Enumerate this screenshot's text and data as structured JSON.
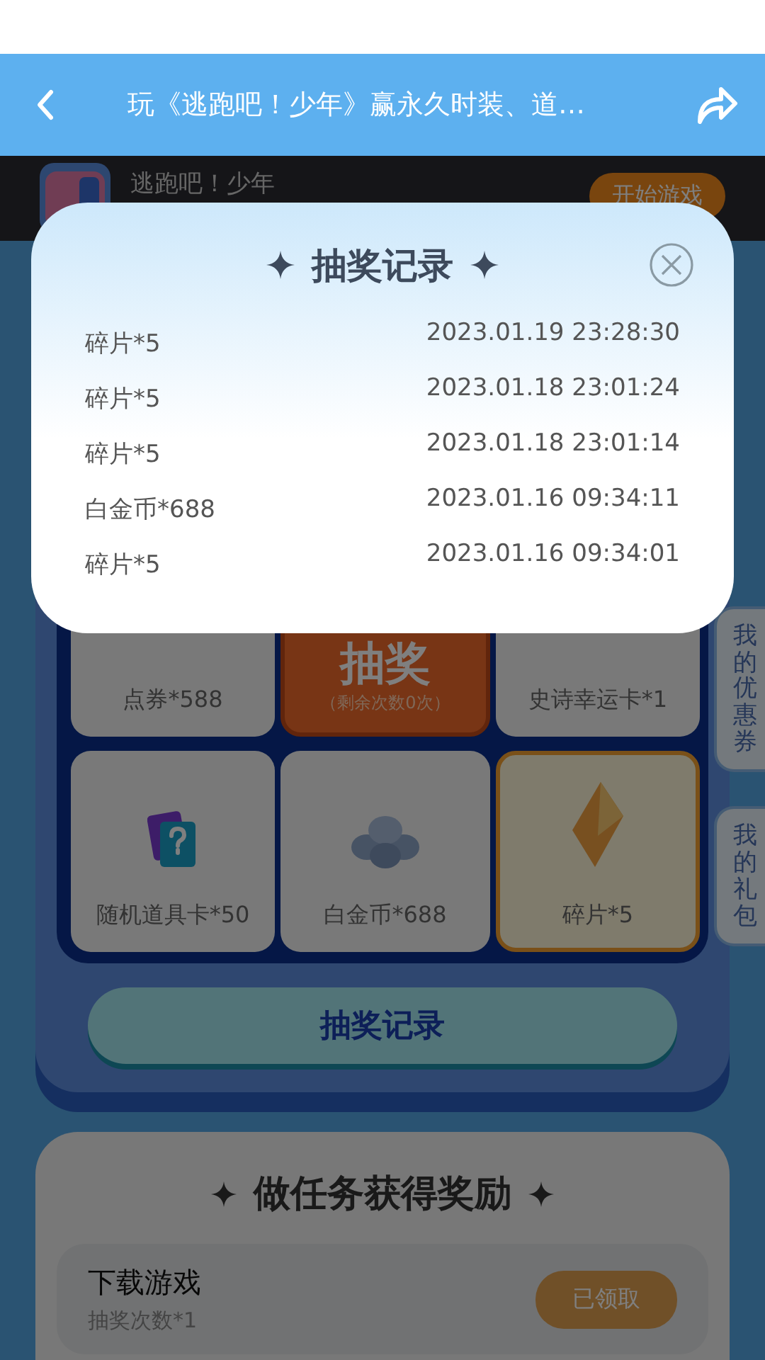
{
  "header": {
    "title": "玩《逃跑吧！少年》赢永久时装、道…"
  },
  "game": {
    "name": "逃跑吧！少年",
    "button": "开始游戏"
  },
  "prizes": [
    {
      "kind": "prize",
      "label": "点券*588",
      "selected": false
    },
    {
      "kind": "draw",
      "label": "抽奖",
      "sub": "（剩余次数0次）",
      "selected": false
    },
    {
      "kind": "prize",
      "label": "史诗幸运卡*1",
      "selected": false
    },
    {
      "kind": "mystery",
      "label": "随机道具卡*50",
      "selected": false
    },
    {
      "kind": "coins",
      "label": "白金币*688",
      "selected": false
    },
    {
      "kind": "shard",
      "label": "碎片*5",
      "selected": true
    }
  ],
  "record_button": "抽奖记录",
  "side_tabs": [
    {
      "label": "我的优惠券"
    },
    {
      "label": "我的礼包"
    }
  ],
  "tasks": {
    "title": "做任务获得奖励",
    "items": [
      {
        "name": "下载游戏",
        "reward": "抽奖次数*1",
        "button": "已领取",
        "disabled": true
      }
    ]
  },
  "dialog": {
    "title": "抽奖记录",
    "records": [
      {
        "prize": "碎片*5",
        "time": "2023.01.19 23:28:30"
      },
      {
        "prize": "碎片*5",
        "time": "2023.01.18 23:01:24"
      },
      {
        "prize": "碎片*5",
        "time": "2023.01.18 23:01:14"
      },
      {
        "prize": "白金币*688",
        "time": "2023.01.16 09:34:11"
      },
      {
        "prize": "碎片*5",
        "time": "2023.01.16 09:34:01"
      }
    ]
  }
}
